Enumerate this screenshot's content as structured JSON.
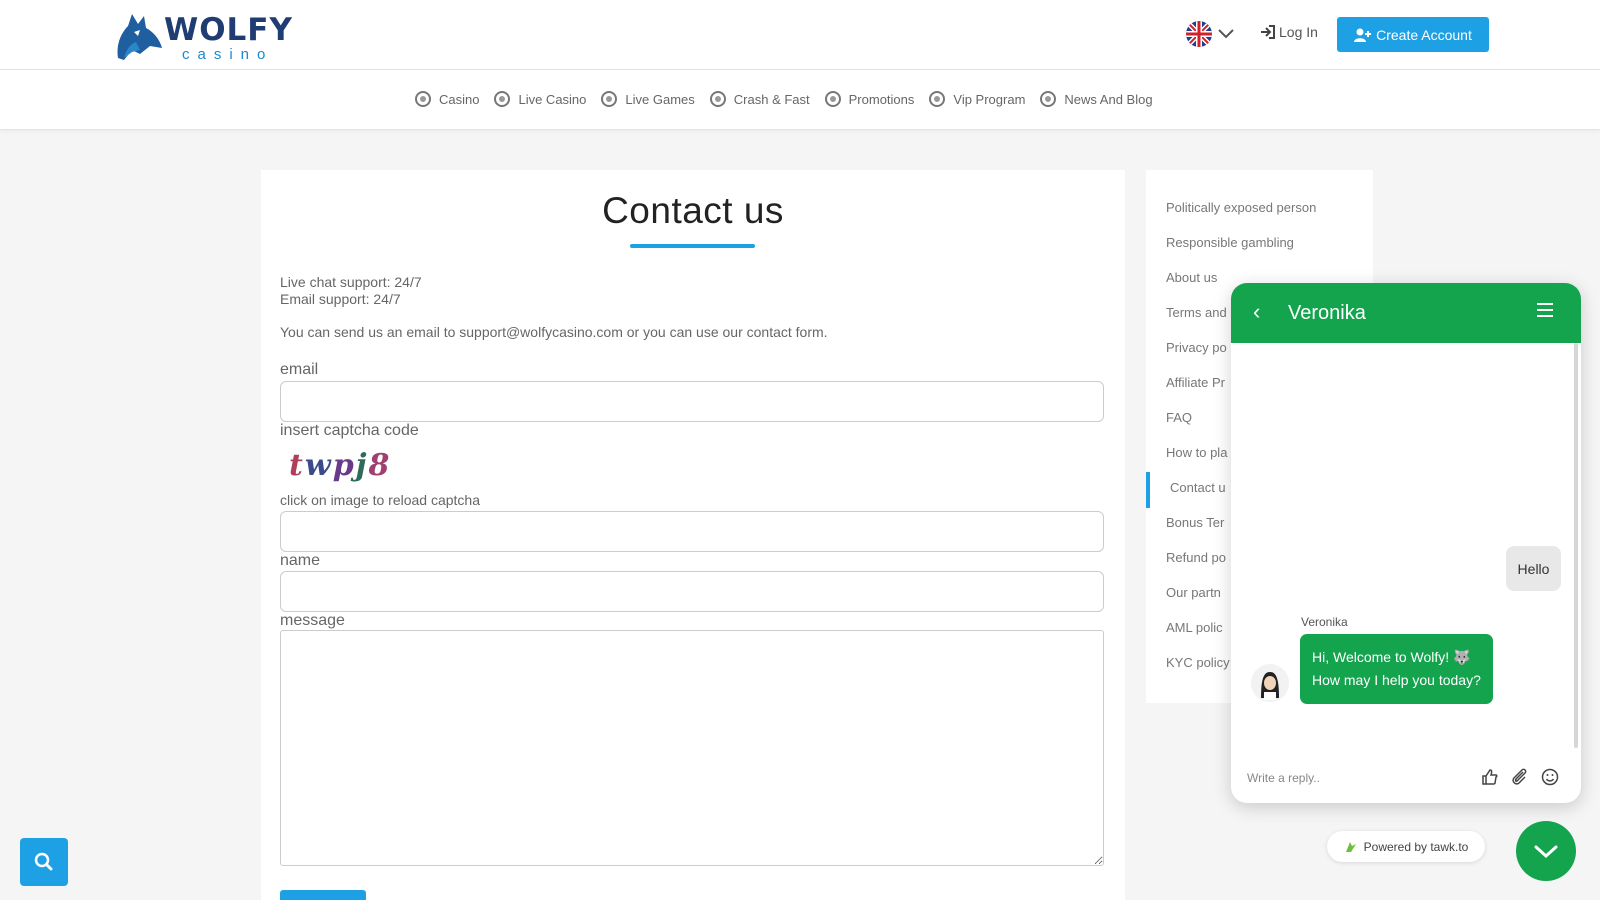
{
  "header": {
    "logo_text": "WOLFY",
    "logo_sub": "casino",
    "login_label": "Log In",
    "create_account_label": "Create Account",
    "language": "English"
  },
  "nav": {
    "items": [
      {
        "label": "Casino",
        "icon": "casino-icon"
      },
      {
        "label": "Live Casino",
        "icon": "live-casino-icon"
      },
      {
        "label": "Live Games",
        "icon": "live-games-icon"
      },
      {
        "label": "Crash & Fast",
        "icon": "rocket-icon"
      },
      {
        "label": "Promotions",
        "icon": "gift-icon"
      },
      {
        "label": "Vip Program",
        "icon": "crown-icon"
      },
      {
        "label": "News And Blog",
        "icon": "news-icon"
      }
    ]
  },
  "contact": {
    "title": "Contact us",
    "live_chat": "Live chat support: 24/7",
    "email_support": "Email support: 24/7",
    "intro": "You can send us an email to support@wolfycasino.com or you can use our contact form.",
    "email_label": "email",
    "captcha_label": "insert captcha code",
    "captcha_code": "twpj8",
    "captcha_hint": "click on image to reload captcha",
    "name_label": "name",
    "message_label": "message"
  },
  "sidebar": {
    "items": [
      "Politically exposed person",
      "Responsible gambling",
      "About us",
      "Terms and",
      "Privacy po",
      "Affiliate Pr",
      "FAQ",
      "How to pla",
      "Contact u",
      "Bonus Ter",
      "Refund po",
      "Our partn",
      "AML polic",
      "KYC policy"
    ],
    "active": "Contact u"
  },
  "chat": {
    "agent": "Veronika",
    "user_message": "Hello",
    "agent_label": "Veronika",
    "agent_message_1": "Hi, Welcome to Wolfy! 🐺",
    "agent_message_2": "How may I help you today?",
    "reply_placeholder": "Write a reply..",
    "powered_by": "Powered by tawk.to"
  },
  "colors": {
    "accent": "#1ea1e4",
    "chat_green": "#14a44d"
  }
}
